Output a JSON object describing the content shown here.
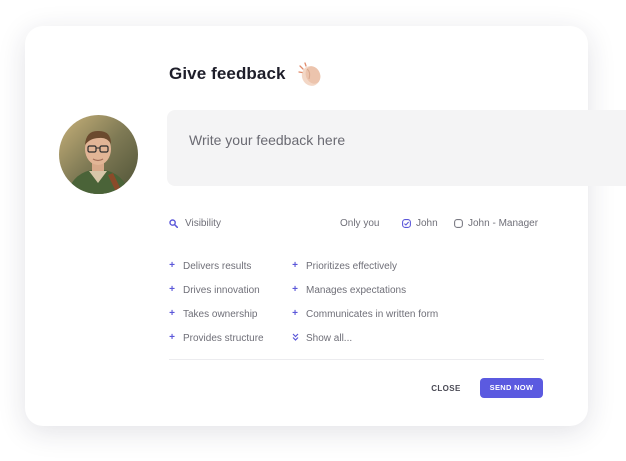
{
  "header": {
    "title": "Give feedback",
    "title_icon": "clapping-hands-icon"
  },
  "composer": {
    "placeholder": "Write your feedback here"
  },
  "visibility": {
    "label": "Visibility",
    "icon": "magnifier-icon",
    "options": [
      {
        "label": "Only you",
        "selected": false
      },
      {
        "label": "John",
        "selected": true
      },
      {
        "label": "John - Manager",
        "selected": false
      }
    ]
  },
  "tags": {
    "left": [
      "Delivers results",
      "Drives innovation",
      "Takes ownership",
      "Provides structure"
    ],
    "right": [
      "Prioritizes effectively",
      "Manages expectations",
      "Communicates in written form"
    ],
    "show_all": "Show all..."
  },
  "actions": {
    "close": "CLOSE",
    "send": "SEND NOW"
  },
  "colors": {
    "accent": "#5b5ae0",
    "input_bg": "#f4f4f5",
    "text_muted": "#6f6f78"
  }
}
